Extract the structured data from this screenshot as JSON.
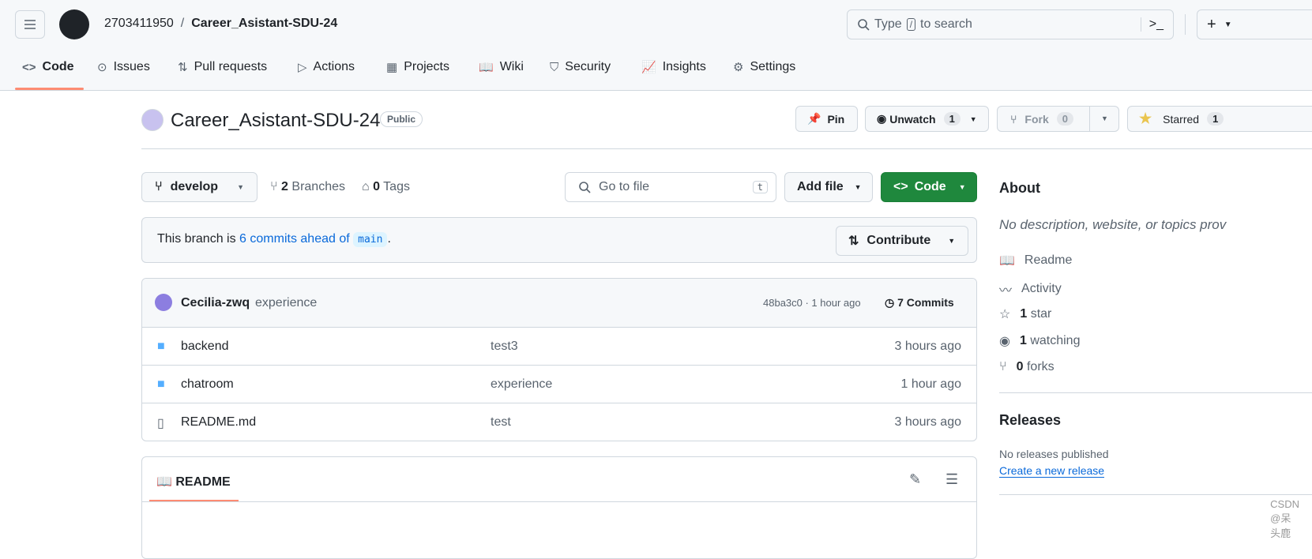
{
  "header": {
    "owner": "2703411950",
    "separator": "/",
    "repo": "Career_Asistant-SDU-24",
    "search_placeholder_pre": "Type",
    "search_key": "/",
    "search_placeholder_post": "to search"
  },
  "tabs": [
    {
      "label": "Code",
      "icon": "code-icon"
    },
    {
      "label": "Issues",
      "icon": "issue-icon"
    },
    {
      "label": "Pull requests",
      "icon": "pull-request-icon"
    },
    {
      "label": "Actions",
      "icon": "play-icon"
    },
    {
      "label": "Projects",
      "icon": "table-icon"
    },
    {
      "label": "Wiki",
      "icon": "book-icon"
    },
    {
      "label": "Security",
      "icon": "shield-icon"
    },
    {
      "label": "Insights",
      "icon": "graph-icon"
    },
    {
      "label": "Settings",
      "icon": "gear-icon"
    }
  ],
  "repo": {
    "name": "Career_Asistant-SDU-24",
    "visibility": "Public",
    "pin": "Pin",
    "unwatch": "Unwatch",
    "watch_count": "1",
    "fork": "Fork",
    "fork_count": "0",
    "starred": "Starred",
    "star_count": "1"
  },
  "toolbar": {
    "branch": "develop",
    "branches_count": "2",
    "branches_label": "Branches",
    "tags_count": "0",
    "tags_label": "Tags",
    "goto_placeholder": "Go to file",
    "goto_key": "t",
    "add_file": "Add file",
    "code": "Code"
  },
  "banner": {
    "pre": "This branch is",
    "link": "6 commits ahead of",
    "branch": "main",
    "post": ".",
    "contribute": "Contribute"
  },
  "commit": {
    "author": "Cecilia-zwq",
    "message": "experience",
    "hash_time": "48ba3c0 · 1 hour ago",
    "commits": "7 Commits"
  },
  "files": [
    {
      "name": "backend",
      "type": "folder",
      "message": "test3",
      "time": "3 hours ago"
    },
    {
      "name": "chatroom",
      "type": "folder",
      "message": "experience",
      "time": "1 hour ago"
    },
    {
      "name": "README.md",
      "type": "file",
      "message": "test",
      "time": "3 hours ago"
    }
  ],
  "readme": {
    "label": "README"
  },
  "about": {
    "title": "About",
    "description": "No description, website, or topics prov",
    "readme": "Readme",
    "activity": "Activity",
    "stars_n": "1",
    "stars": "star",
    "watching_n": "1",
    "watching": "watching",
    "forks_n": "0",
    "forks": "forks"
  },
  "releases": {
    "title": "Releases",
    "none": "No releases published",
    "create": "Create a new release"
  },
  "watermark": "CSDN @呆头鹿",
  "colors": {
    "accent": "#1f883d",
    "link": "#0969da",
    "tab_underline": "#fd8c73",
    "folder": "#54aeff",
    "star": "#eac54f"
  }
}
